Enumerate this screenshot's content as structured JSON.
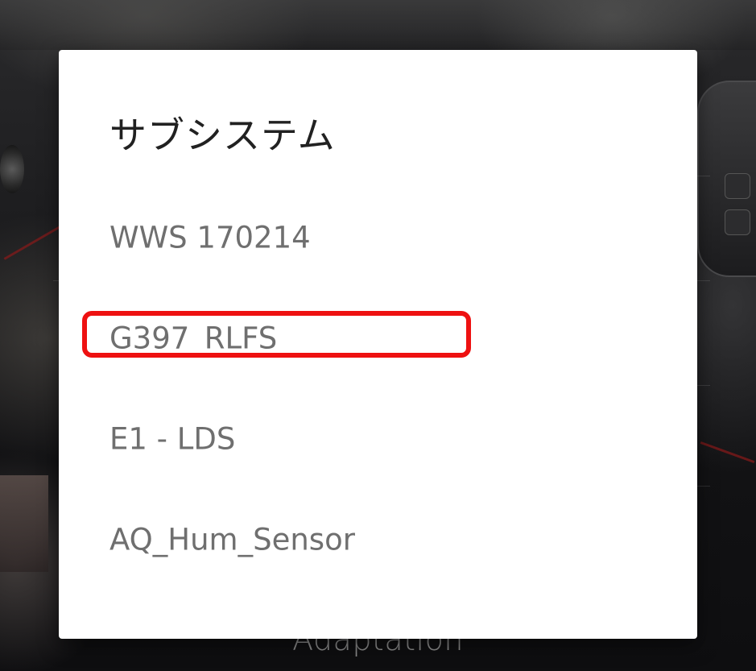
{
  "background": {
    "label": "Adaptation"
  },
  "dialog": {
    "title": "サブシステム",
    "options": [
      {
        "label": "WWS 170214"
      },
      {
        "label": "G397_RLFS",
        "highlighted": true
      },
      {
        "label": "E1 - LDS"
      },
      {
        "label": "AQ_Hum_Sensor"
      }
    ]
  },
  "colors": {
    "highlight": "#ee1111",
    "dialog_background": "#ffffff",
    "title_text": "#212121",
    "option_text": "#6f6f6f"
  }
}
